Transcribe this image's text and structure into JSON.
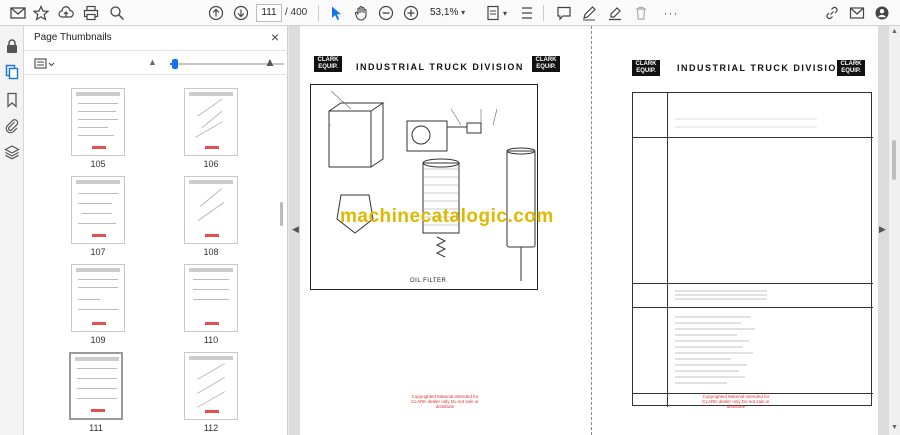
{
  "toolbar": {
    "page_current": "111",
    "page_total": "/ 400",
    "zoom": "53,1%"
  },
  "panel": {
    "title": "Page Thumbnails",
    "close_glyph": "×"
  },
  "thumbnails": [
    {
      "label": "105"
    },
    {
      "label": "106"
    },
    {
      "label": "107"
    },
    {
      "label": "108"
    },
    {
      "label": "109"
    },
    {
      "label": "110"
    },
    {
      "label": "111",
      "selected": true
    },
    {
      "label": "112"
    }
  ],
  "document": {
    "left_page": {
      "division_title": "INDUSTRIAL TRUCK DIVISION",
      "logo_text": "CLARK EQUIPMENT",
      "caption": "OIL FILTER",
      "copy_note": "Copyrighted Material Intended for CLARK dealer only Do not sale or distribute"
    },
    "right_page": {
      "division_title": "INDUSTRIAL TRUCK DIVISION",
      "logo_text": "CLARK EQUIPMENT",
      "copy_note": "Copyrighted Material Intended for CLARK dealer only Do not sale or distribute"
    },
    "watermark": "machinecatalogic.com"
  },
  "icons": {
    "bookmark": "star-icon",
    "upload": "upload-cloud-icon",
    "print": "print-icon",
    "find": "magnifier-icon",
    "prev": "arrow-up-circle-icon",
    "next": "arrow-down-circle-icon",
    "select": "cursor-icon",
    "hand": "hand-icon",
    "zoom_out": "minus-circle-icon",
    "zoom_in": "plus-circle-icon"
  }
}
